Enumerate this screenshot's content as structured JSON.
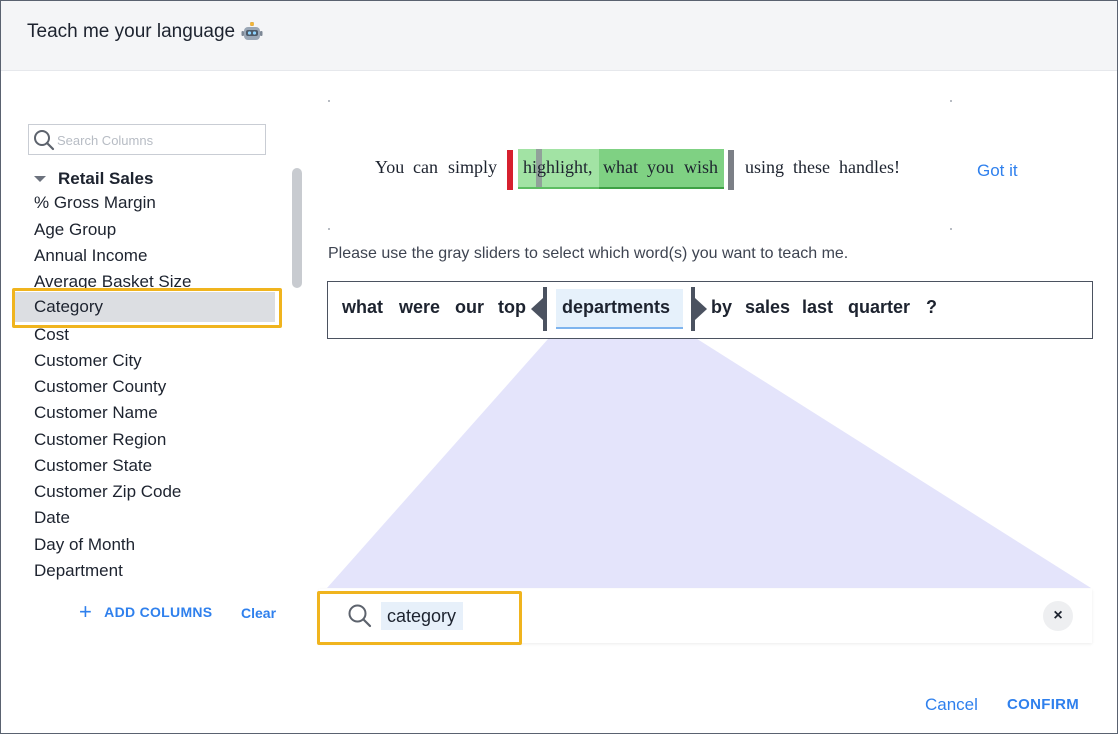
{
  "dialog": {
    "title": "Teach me your language"
  },
  "sidebar": {
    "search_placeholder": "Search Columns",
    "group_label": "Retail Sales",
    "columns": [
      "% Gross Margin",
      "Age Group",
      "Annual Income",
      "Average Basket Size",
      "Category",
      "Cost",
      "Customer City",
      "Customer County",
      "Customer Name",
      "Customer Region",
      "Customer State",
      "Customer Zip Code",
      "Date",
      "Day of Month",
      "Department"
    ],
    "selected_column": "Category",
    "add_columns_label": "ADD COLUMNS",
    "clear_label": "Clear"
  },
  "tutorial": {
    "words_before": [
      "You",
      "can",
      "simply"
    ],
    "word_highlight_light": "highlight,",
    "words_highlight_dark": [
      "what",
      "you",
      "wish"
    ],
    "words_after": [
      "using",
      "these",
      "handles!"
    ],
    "got_it_label": "Got it"
  },
  "instruction": "Please use the gray sliders to select which word(s) you want to teach me.",
  "query": {
    "words": [
      "what",
      "were",
      "our",
      "top",
      "departments",
      "by",
      "sales",
      "last",
      "quarter",
      "?"
    ],
    "selected_word": "departments"
  },
  "mapping_search": {
    "value": "category",
    "clear_icon": "×"
  },
  "footer": {
    "cancel_label": "Cancel",
    "confirm_label": "CONFIRM"
  },
  "colors": {
    "accent": "#2f80ed",
    "highlight_border": "#f0b41e",
    "handle_red": "#d6202e",
    "green_highlight": "#7fd183",
    "projection_fill": "#e4e4fb"
  }
}
